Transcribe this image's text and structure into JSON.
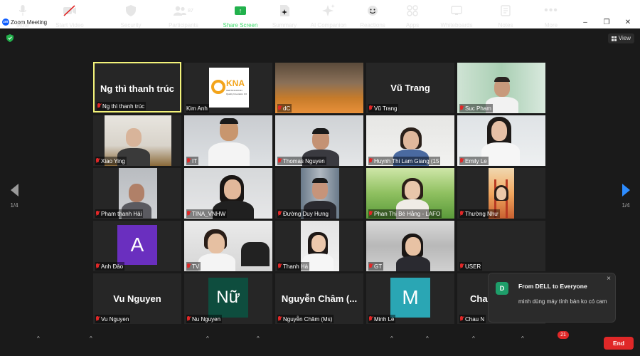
{
  "window": {
    "title": "Zoom Meeting",
    "view_label": "View",
    "page_indicator_left": "1/4",
    "page_indicator_right": "1/4"
  },
  "participants": [
    {
      "name": "Ng thì thanh trúc",
      "display": "Ng thì thanh trúc",
      "kind": "name",
      "active": true
    },
    {
      "name": "Kim Anh",
      "display": "KNA",
      "kind": "logo"
    },
    {
      "name": "dC",
      "kind": "photo"
    },
    {
      "name": "Vũ Trang",
      "display": "Vũ Trang",
      "kind": "name"
    },
    {
      "name": "Suc Pham",
      "kind": "photo"
    },
    {
      "name": "Xiao Ying",
      "kind": "photo"
    },
    {
      "name": "IT",
      "kind": "photo"
    },
    {
      "name": "Thomas Nguyen",
      "kind": "photo"
    },
    {
      "name": "Huynh Thi Lam Giang (15",
      "kind": "photo"
    },
    {
      "name": "Emily Le",
      "kind": "photo"
    },
    {
      "name": "Pham thanh Hải",
      "kind": "photo"
    },
    {
      "name": "TINA_VNHW",
      "kind": "photo"
    },
    {
      "name": "Đường Duy Hưng",
      "kind": "photo"
    },
    {
      "name": "Phan Thị Bé Hằng - LAFO",
      "kind": "photo"
    },
    {
      "name": "Thường Như",
      "kind": "photo"
    },
    {
      "name": "Anh Đào",
      "display": "A",
      "kind": "avatar",
      "color": "#6a2fbf"
    },
    {
      "name": "TV",
      "kind": "photo"
    },
    {
      "name": "Thanh Hà",
      "kind": "photo"
    },
    {
      "name": "GT",
      "kind": "photo"
    },
    {
      "name": "USER",
      "kind": "blank"
    },
    {
      "name": "Vu Nguyen",
      "display": "Vu Nguyen",
      "kind": "name"
    },
    {
      "name": "Nu Nguyen",
      "display": "Nữ",
      "kind": "avatar",
      "color": "#0e4d3e"
    },
    {
      "name": "Nguyễn Châm (Ms)",
      "display": "Nguyễn Châm (...",
      "kind": "name"
    },
    {
      "name": "Minh Le",
      "display": "M",
      "kind": "avatar",
      "color": "#2aa6b4"
    },
    {
      "name": "Chau N",
      "display": "Cha",
      "kind": "name"
    }
  ],
  "kna_logo": {
    "title": "KNA",
    "sub": "CERTIFICATION",
    "tag": "Quality Innovation 3.0"
  },
  "toast": {
    "badge": "D",
    "from": "From DELL to Everyone",
    "message": "minh dùng máy tính bàn ko có cam",
    "close": "×"
  },
  "toolbar": {
    "mute": "Mute",
    "start_video": "Start Video",
    "security": "Security",
    "participants": "Participants",
    "participants_count": "87",
    "share_screen": "Share Screen",
    "summary": "Summary",
    "ai_companion": "AI Companion",
    "reactions": "Reactions",
    "apps": "Apps",
    "whiteboards": "Whiteboards",
    "notes": "Notes",
    "more": "More",
    "more_badge": "21",
    "end": "End"
  },
  "colors": {
    "background": "#1a1a1a",
    "tile": "#262626",
    "active_border": "#f3f37a",
    "end_button": "#e02828",
    "share_green": "#22b14c",
    "accent_blue": "#2d8cff"
  }
}
